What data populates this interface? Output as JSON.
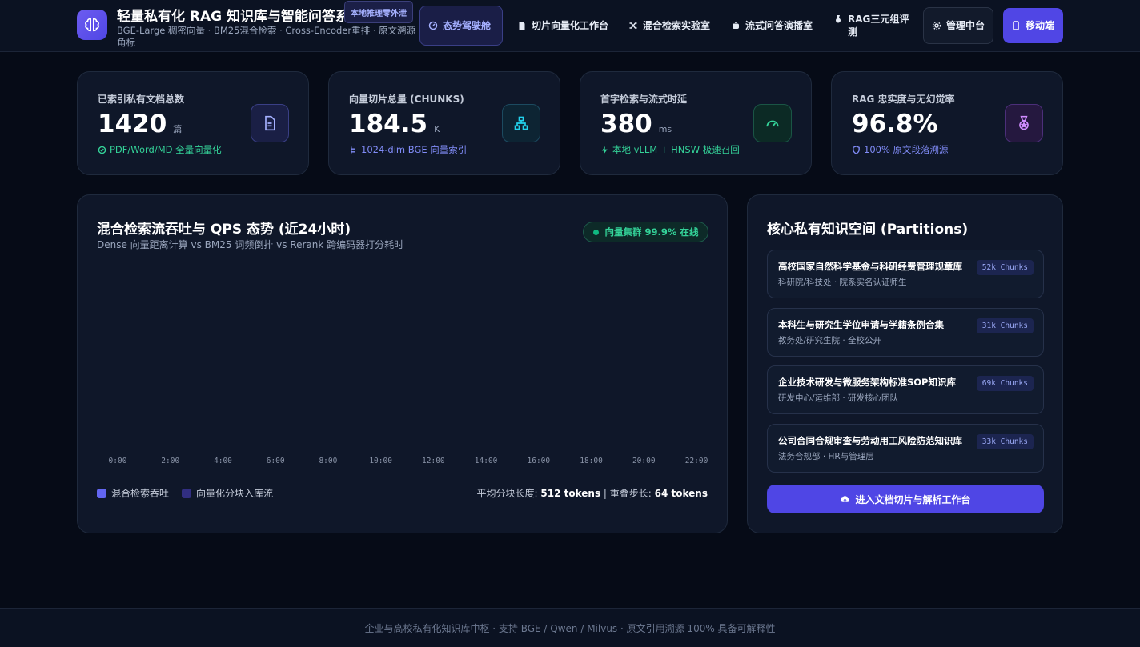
{
  "header": {
    "title": "轻量私有化 RAG 知识库与智能问答系统",
    "badge": "本地推理零外泄",
    "subtitle": "BGE-Large 稠密向量 · BM25混合检索 · Cross-Encoder重排 · 原文溯源角标",
    "nav": [
      {
        "label": "态势驾驶舱",
        "icon": "dashboard-icon",
        "active": true
      },
      {
        "label": "切片向量化工作台",
        "icon": "document-icon"
      },
      {
        "label": "混合检索实验室",
        "icon": "shuffle-icon"
      },
      {
        "label": "流式问答演播室",
        "icon": "robot-icon"
      },
      {
        "label": "RAG三元组评测",
        "icon": "medal-icon"
      },
      {
        "label": "管理中台",
        "icon": "gear-icon"
      },
      {
        "label": "移动端",
        "icon": "mobile-icon"
      }
    ]
  },
  "stats": [
    {
      "label": "已索引私有文档总数",
      "value": "1420",
      "unit": "篇",
      "note": "PDF/Word/MD 全量向量化",
      "note_color": "#34d399",
      "icon": "document-icon"
    },
    {
      "label": "向量切片总量 (CHUNKS)",
      "value": "184.5",
      "unit": "K",
      "note": "1024-dim BGE 向量索引",
      "note_color": "#818cf8",
      "icon": "sitemap-icon"
    },
    {
      "label": "首字检索与流式时延",
      "value": "380",
      "unit": "ms",
      "note": "本地 vLLM + HNSW 极速召回",
      "note_color": "#34d399",
      "icon": "gauge-icon"
    },
    {
      "label": "RAG 忠实度与无幻觉率",
      "value": "96.8%",
      "unit": "",
      "note": "100% 原文段落溯源",
      "note_color": "#818cf8",
      "icon": "medal-icon"
    }
  ],
  "chart_panel": {
    "title": "混合检索流吞吐与 QPS 态势 (近24小时)",
    "subtitle": "Dense 向量距离计算 vs BM25 词频倒排 vs Rerank 跨编码器打分耗时",
    "badge": "向量集群 99.9% 在线",
    "chunk_prefix": "平均分块长度:",
    "chunk_len": "512 tokens",
    "overlap_prefix": "重叠步长:",
    "overlap_len": "64 tokens"
  },
  "chart_data": {
    "type": "bar",
    "categories": [
      "0:00",
      "2:00",
      "4:00",
      "6:00",
      "8:00",
      "10:00",
      "12:00",
      "14:00",
      "16:00",
      "18:00",
      "20:00",
      "22:00"
    ],
    "series": [
      {
        "name": "混合检索吞吐",
        "color": "#6366f1",
        "values": []
      },
      {
        "name": "向量化分块入库流",
        "color": "#312e81",
        "values": []
      }
    ]
  },
  "partitions": {
    "title": "核心私有知识空间 (Partitions)",
    "items": [
      {
        "name": "高校国家自然科学基金与科研经费管理规章库",
        "meta": "科研院/科技处 · 院系实名认证师生",
        "chunks": "52k Chunks"
      },
      {
        "name": "本科生与研究生学位申请与学籍条例合集",
        "meta": "教务处/研究生院 · 全校公开",
        "chunks": "31k Chunks"
      },
      {
        "name": "企业技术研发与微服务架构标准SOP知识库",
        "meta": "研发中心/运维部 · 研发核心团队",
        "chunks": "69k Chunks"
      },
      {
        "name": "公司合同合规审查与劳动用工风险防范知识库",
        "meta": "法务合规部 · HR与管理层",
        "chunks": "33k Chunks"
      }
    ],
    "button": "进入文档切片与解析工作台"
  },
  "footer": {
    "text": "企业与高校私有化知识库中枢 · 支持 BGE / Qwen / Milvus · 原文引用溯源 100% 具备可解释性"
  }
}
